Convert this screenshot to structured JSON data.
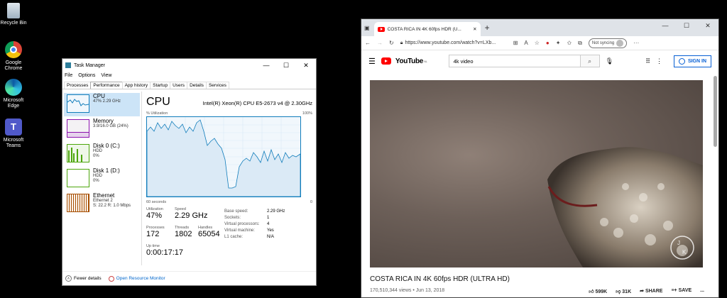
{
  "desktop": {
    "icons": [
      {
        "label": "Recycle Bin",
        "icon": "recycle-bin-icon"
      },
      {
        "label": "Google Chrome",
        "icon": "chrome-icon"
      },
      {
        "label": "Microsoft Edge",
        "icon": "edge-icon"
      },
      {
        "label": "Microsoft Teams",
        "icon": "teams-icon"
      }
    ]
  },
  "taskmanager": {
    "title": "Task Manager",
    "menu": [
      "File",
      "Options",
      "View"
    ],
    "tabs": [
      "Processes",
      "Performance",
      "App history",
      "Startup",
      "Users",
      "Details",
      "Services"
    ],
    "active_tab": "Performance",
    "sidebar": [
      {
        "name": "CPU",
        "sub1": "47% 2.29 GHz",
        "sub2": ""
      },
      {
        "name": "Memory",
        "sub1": "3.9/16.0 GB (24%)",
        "sub2": ""
      },
      {
        "name": "Disk 0 (C:)",
        "sub1": "HDD",
        "sub2": "0%"
      },
      {
        "name": "Disk 1 (D:)",
        "sub1": "HDD",
        "sub2": "0%"
      },
      {
        "name": "Ethernet",
        "sub1": "Ethernet 2",
        "sub2": "S: 22.2  R: 1.0 Mbps"
      }
    ],
    "main": {
      "heading": "CPU",
      "model": "Intel(R) Xeon(R) CPU E5-2673 v4 @ 2.30GHz",
      "util_label": "% Utilization",
      "max_label": "100%",
      "time_label": "60 seconds",
      "min_label": "0",
      "utilization_label": "Utilization",
      "utilization": "47%",
      "speed_label": "Speed",
      "speed": "2.29 GHz",
      "processes_label": "Processes",
      "processes": "172",
      "threads_label": "Threads",
      "threads": "1802",
      "handles_label": "Handles",
      "handles": "65054",
      "uptime_label": "Up time",
      "uptime": "0:00:17:17",
      "details": [
        {
          "k": "Base speed:",
          "v": "2.29 GHz"
        },
        {
          "k": "Sockets:",
          "v": "1"
        },
        {
          "k": "Virtual processors:",
          "v": "4"
        },
        {
          "k": "Virtual machine:",
          "v": "Yes"
        },
        {
          "k": "L1 cache:",
          "v": "N/A"
        }
      ]
    },
    "footer": {
      "fewer": "Fewer details",
      "monitor": "Open Resource Monitor"
    }
  },
  "browser": {
    "tab_title": "COSTA RICA IN 4K 60fps HDR (U...",
    "url": "https://www.youtube.com/watch?v=LXb...",
    "sync_label": "Not syncing",
    "logo_text": "YouTube",
    "logo_region": "NL",
    "search_value": "4k video",
    "signin_label": "SIGN IN",
    "video_title": "COSTA RICA IN 4K 60fps HDR (ULTRA HD)",
    "views": "170,510,344 views • Jun 13, 2018",
    "likes": "599K",
    "dislikes": "31K",
    "share": "SHARE",
    "save": "SAVE",
    "more": "..."
  }
}
